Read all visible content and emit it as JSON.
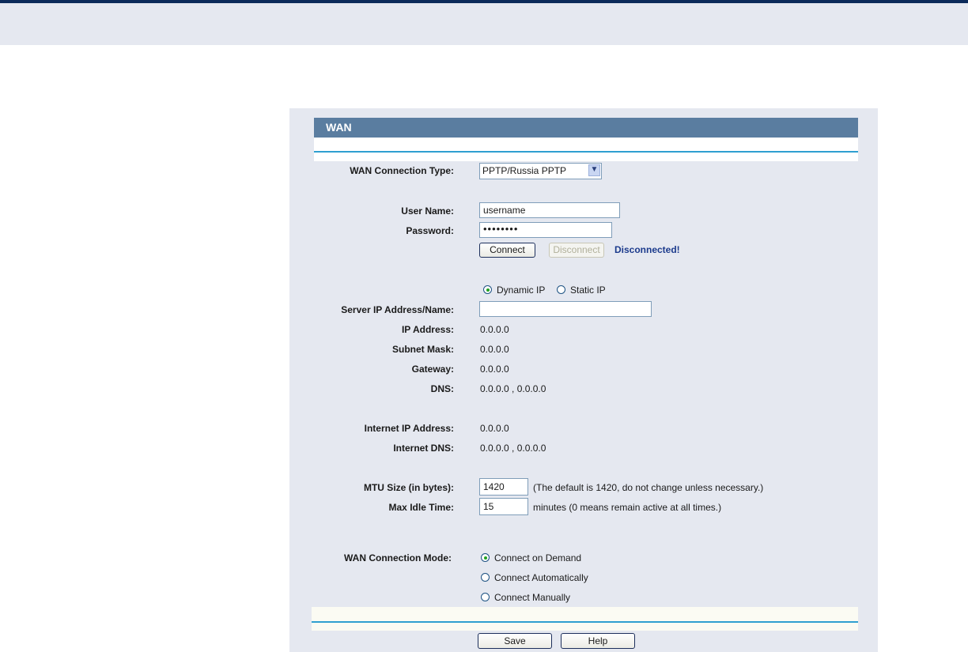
{
  "section_title": "WAN",
  "connection_type": {
    "label": "WAN Connection Type:",
    "value": "PPTP/Russia PPTP"
  },
  "username": {
    "label": "User Name:",
    "value": "username"
  },
  "password": {
    "label": "Password:",
    "value": "••••••••"
  },
  "connect_button": "Connect",
  "disconnect_button": "Disconnect",
  "status": "Disconnected!",
  "ip_mode": {
    "dynamic": "Dynamic IP",
    "static": "Static IP",
    "selected": "Dynamic IP"
  },
  "server_ip": {
    "label": "Server IP Address/Name:",
    "value": ""
  },
  "ip_address": {
    "label": "IP Address:",
    "value": "0.0.0.0"
  },
  "subnet_mask": {
    "label": "Subnet Mask:",
    "value": "0.0.0.0"
  },
  "gateway": {
    "label": "Gateway:",
    "value": "0.0.0.0"
  },
  "dns": {
    "label": "DNS:",
    "value": "0.0.0.0 , 0.0.0.0"
  },
  "internet_ip": {
    "label": "Internet IP Address:",
    "value": "0.0.0.0"
  },
  "internet_dns": {
    "label": "Internet DNS:",
    "value": "0.0.0.0 , 0.0.0.0"
  },
  "mtu": {
    "label": "MTU Size (in bytes):",
    "value": "1420",
    "note": "(The default is 1420, do not change unless necessary.)"
  },
  "max_idle": {
    "label": "Max Idle Time:",
    "value": "15",
    "note": "minutes (0 means remain active at all times.)"
  },
  "connection_mode": {
    "label": "WAN Connection Mode:",
    "options": [
      "Connect on Demand",
      "Connect Automatically",
      "Connect Manually"
    ],
    "selected": "Connect on Demand"
  },
  "save_button": "Save",
  "help_button": "Help",
  "colors": {
    "header": "#5a7da0",
    "status_text": "#1b3a8c",
    "divider": "#2f9fd0",
    "background": "#e5e8f0"
  }
}
